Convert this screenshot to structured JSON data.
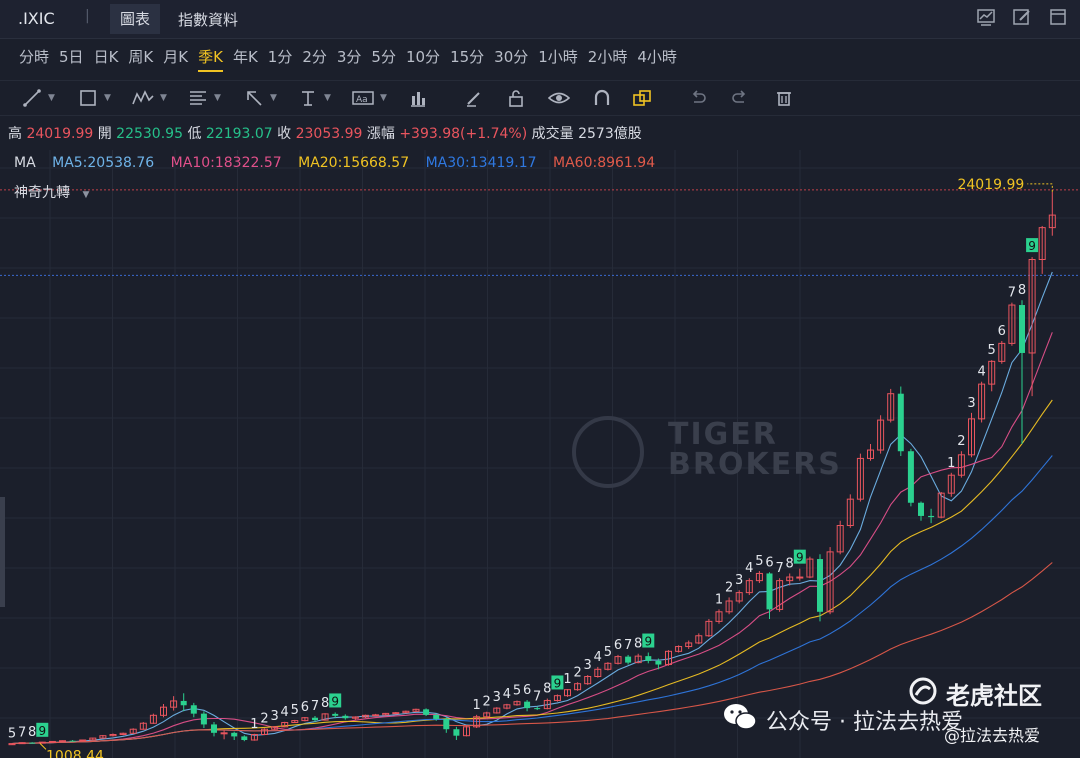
{
  "header": {
    "symbol": ".IXIC",
    "separator": "|",
    "tabs": [
      {
        "label": "圖表",
        "active": true
      },
      {
        "label": "指數資料",
        "active": false
      }
    ],
    "icons": [
      "chart-settings-icon",
      "edit-icon",
      "window-icon"
    ]
  },
  "periods": [
    {
      "label": "分時"
    },
    {
      "label": "5日"
    },
    {
      "label": "日K"
    },
    {
      "label": "周K"
    },
    {
      "label": "月K"
    },
    {
      "label": "季K",
      "active": true
    },
    {
      "label": "年K"
    },
    {
      "label": "1分"
    },
    {
      "label": "2分"
    },
    {
      "label": "3分"
    },
    {
      "label": "5分"
    },
    {
      "label": "10分"
    },
    {
      "label": "15分"
    },
    {
      "label": "30分"
    },
    {
      "label": "1小時"
    },
    {
      "label": "2小時"
    },
    {
      "label": "4小時"
    }
  ],
  "tools": [
    "line-tool-icon",
    "rectangle-tool-icon",
    "wave-tool-icon",
    "fibonacci-tool-icon",
    "arrow-tool-icon",
    "text-tool-icon",
    "label-tool-icon",
    "bar-tool-icon",
    "brush-icon",
    "unlock-icon",
    "eye-icon",
    "magnet-icon",
    "copy-icon",
    "undo-icon",
    "redo-icon",
    "trash-icon"
  ],
  "ohlc": {
    "high_label": "高",
    "high": "24019.99",
    "open_label": "開",
    "open": "22530.95",
    "low_label": "低",
    "low": "22193.07",
    "close_label": "收",
    "close": "23053.99",
    "change_label": "漲幅",
    "change": "+393.98(+1.74%)",
    "volume_label": "成交量",
    "volume": "2573億股"
  },
  "ma": {
    "label": "MA",
    "ma5": "MA5:20538.76",
    "ma10": "MA10:18322.57",
    "ma20": "MA20:15668.57",
    "ma30": "MA30:13419.17",
    "ma60": "MA60:8961.94",
    "colors": {
      "ma5": "#6fb3e8",
      "ma10": "#e0508a",
      "ma20": "#f0c323",
      "ma30": "#2f78e0",
      "ma60": "#e05a4a"
    }
  },
  "indicator": {
    "label": "神奇九轉"
  },
  "chart_data": {
    "type": "candlestick",
    "high_marker": "24019.99",
    "low_marker": "1008.44",
    "watermark": [
      "TIGER",
      "BROKERS"
    ],
    "candles": [
      [
        955,
        1000,
        940,
        1010
      ],
      [
        1000,
        1040,
        985,
        1055
      ],
      [
        1040,
        1020,
        1005,
        1060
      ],
      [
        1020,
        1060,
        1010,
        1075
      ],
      [
        1060,
        1090,
        1045,
        1105
      ],
      [
        1090,
        1120,
        1075,
        1135
      ],
      [
        1120,
        1110,
        1095,
        1150
      ],
      [
        1110,
        1150,
        1100,
        1170
      ],
      [
        1150,
        1230,
        1140,
        1250
      ],
      [
        1230,
        1330,
        1210,
        1360
      ],
      [
        1330,
        1380,
        1300,
        1420
      ],
      [
        1380,
        1430,
        1350,
        1460
      ],
      [
        1430,
        1600,
        1410,
        1640
      ],
      [
        1600,
        1850,
        1580,
        1900
      ],
      [
        1850,
        2180,
        1820,
        2250
      ],
      [
        2180,
        2520,
        2100,
        2650
      ],
      [
        2520,
        2780,
        2380,
        2980
      ],
      [
        2780,
        2600,
        2350,
        3100
      ],
      [
        2600,
        2250,
        2100,
        2700
      ],
      [
        2250,
        1800,
        1650,
        2350
      ],
      [
        1800,
        1450,
        1300,
        1900
      ],
      [
        1450,
        1450,
        1180,
        1550
      ],
      [
        1450,
        1300,
        1150,
        1500
      ],
      [
        1300,
        1150,
        1100,
        1350
      ],
      [
        1150,
        1380,
        1120,
        1410
      ],
      [
        1380,
        1600,
        1360,
        1640
      ],
      [
        1600,
        1700,
        1570,
        1730
      ],
      [
        1700,
        1880,
        1680,
        1910
      ],
      [
        1880,
        1960,
        1860,
        1990
      ],
      [
        1960,
        2080,
        1930,
        2110
      ],
      [
        2080,
        1980,
        1900,
        2150
      ],
      [
        1980,
        2240,
        1960,
        2270
      ],
      [
        2240,
        2160,
        2060,
        2300
      ],
      [
        2160,
        2060,
        2000,
        2220
      ],
      [
        2060,
        2110,
        1990,
        2140
      ],
      [
        2110,
        2180,
        2070,
        2210
      ],
      [
        2180,
        2200,
        2150,
        2240
      ],
      [
        2200,
        2260,
        2160,
        2280
      ],
      [
        2260,
        2290,
        2220,
        2320
      ],
      [
        2290,
        2350,
        2260,
        2380
      ],
      [
        2350,
        2430,
        2320,
        2460
      ],
      [
        2430,
        2200,
        2150,
        2470
      ],
      [
        2200,
        2030,
        1950,
        2250
      ],
      [
        2030,
        1600,
        1450,
        2100
      ],
      [
        1600,
        1330,
        1150,
        1700
      ],
      [
        1330,
        1700,
        1300,
        1750
      ],
      [
        1700,
        2120,
        1650,
        2200
      ],
      [
        2120,
        2280,
        2050,
        2330
      ],
      [
        2280,
        2480,
        2250,
        2520
      ],
      [
        2480,
        2620,
        2430,
        2660
      ],
      [
        2620,
        2750,
        2580,
        2800
      ],
      [
        2750,
        2480,
        2350,
        2820
      ],
      [
        2480,
        2460,
        2400,
        2550
      ],
      [
        2460,
        2800,
        2430,
        2880
      ],
      [
        2800,
        3000,
        2750,
        3050
      ],
      [
        3000,
        3250,
        2950,
        3280
      ],
      [
        3250,
        3500,
        3200,
        3560
      ],
      [
        3500,
        3800,
        3450,
        3860
      ],
      [
        3800,
        4100,
        3750,
        4200
      ],
      [
        4100,
        4350,
        4050,
        4400
      ],
      [
        4350,
        4630,
        4300,
        4700
      ],
      [
        4630,
        4380,
        4300,
        4700
      ],
      [
        4380,
        4650,
        4350,
        4750
      ],
      [
        4650,
        4450,
        4350,
        4800
      ],
      [
        4450,
        4300,
        4100,
        4550
      ],
      [
        4300,
        4850,
        4250,
        4900
      ],
      [
        4850,
        5050,
        4800,
        5100
      ],
      [
        5050,
        5200,
        4950,
        5300
      ],
      [
        5200,
        5500,
        5150,
        5600
      ],
      [
        5500,
        6100,
        5450,
        6200
      ],
      [
        6100,
        6500,
        6000,
        6600
      ],
      [
        6500,
        6950,
        6400,
        7100
      ],
      [
        6950,
        7300,
        6850,
        7400
      ],
      [
        7300,
        7800,
        7200,
        7900
      ],
      [
        7800,
        8100,
        7700,
        8200
      ],
      [
        8100,
        6600,
        6200,
        8150
      ],
      [
        6600,
        7800,
        6500,
        7900
      ],
      [
        7800,
        7950,
        7600,
        8100
      ],
      [
        7950,
        7950,
        7800,
        8300
      ],
      [
        7950,
        8700,
        7900,
        8800
      ],
      [
        8700,
        6500,
        6100,
        8900
      ],
      [
        6500,
        9000,
        6400,
        9200
      ],
      [
        9000,
        10100,
        8900,
        10300
      ],
      [
        10100,
        11200,
        10000,
        11400
      ],
      [
        11200,
        12900,
        11100,
        13100
      ],
      [
        12900,
        13250,
        12800,
        13500
      ],
      [
        13250,
        14500,
        13100,
        14700
      ],
      [
        14500,
        15600,
        14400,
        15800
      ],
      [
        15600,
        13200,
        13000,
        15900
      ],
      [
        13200,
        11050,
        10900,
        13300
      ],
      [
        11050,
        10500,
        10300,
        11100
      ],
      [
        10500,
        10450,
        10200,
        10800
      ],
      [
        10450,
        11450,
        10400,
        11500
      ],
      [
        11450,
        12200,
        11300,
        12300
      ],
      [
        12200,
        13050,
        12100,
        13200
      ],
      [
        13050,
        14550,
        12950,
        14800
      ],
      [
        14550,
        16000,
        14400,
        16100
      ],
      [
        16000,
        16950,
        15700,
        17000
      ],
      [
        16950,
        17700,
        16850,
        17800
      ],
      [
        17700,
        19300,
        17600,
        19400
      ],
      [
        19300,
        17300,
        13500,
        19500
      ],
      [
        17300,
        21200,
        15500,
        21300
      ],
      [
        21200,
        22530,
        20600,
        22600
      ],
      [
        22530,
        23053,
        22193,
        24019
      ]
    ],
    "td_marks": [
      {
        "label": "5"
      },
      {
        "label": "7"
      },
      {
        "label": "8"
      },
      {
        "label": "9"
      },
      {
        "label": "1"
      },
      {
        "label": "2"
      },
      {
        "label": "3"
      },
      {
        "label": "4"
      },
      {
        "label": "5"
      },
      {
        "label": "6"
      },
      {
        "label": "7"
      },
      {
        "label": "8"
      },
      {
        "label": "9"
      },
      {
        "label": "1"
      },
      {
        "label": "2"
      },
      {
        "label": "3"
      },
      {
        "label": "4"
      },
      {
        "label": "5"
      },
      {
        "label": "6"
      },
      {
        "label": "7"
      },
      {
        "label": "8"
      },
      {
        "label": "9"
      },
      {
        "label": "1"
      },
      {
        "label": "2"
      },
      {
        "label": "3"
      },
      {
        "label": "4"
      },
      {
        "label": "5"
      },
      {
        "label": "6"
      },
      {
        "label": "7"
      },
      {
        "label": "8"
      },
      {
        "label": "9"
      },
      {
        "label": "1"
      },
      {
        "label": "2"
      },
      {
        "label": "3"
      },
      {
        "label": "4"
      },
      {
        "label": "5"
      },
      {
        "label": "6"
      },
      {
        "label": "7"
      },
      {
        "label": "8"
      },
      {
        "label": "9"
      },
      {
        "label": "1"
      },
      {
        "label": "2"
      },
      {
        "label": "3"
      },
      {
        "label": "4"
      },
      {
        "label": "5"
      },
      {
        "label": "6"
      },
      {
        "label": "7"
      },
      {
        "label": "8"
      },
      {
        "label": "9"
      }
    ]
  },
  "footer": {
    "wechat": "公众号 · 拉法去热爱",
    "brand": "老虎社区",
    "brand_handle": "@拉法去热爱"
  }
}
